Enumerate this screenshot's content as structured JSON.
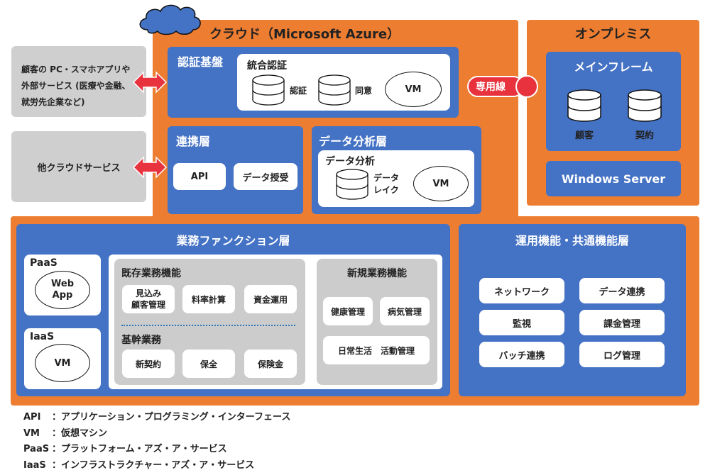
{
  "cloud": {
    "title": "クラウド（Microsoft Azure）",
    "auth_platform": {
      "title": "認証基盤",
      "integrated_auth": {
        "title": "統合認証",
        "db1_label": "認証",
        "db2_label": "同意",
        "vm_label": "VM"
      }
    },
    "integration_layer": {
      "title": "連携層",
      "items": [
        "API",
        "データ授受"
      ]
    },
    "analytics_layer": {
      "title": "データ分析層",
      "box_title": "データ分析",
      "datalake_label_1": "データ",
      "datalake_label_2": "レイク",
      "vm_label": "VM"
    },
    "business_layer": {
      "title": "業務ファンクション層",
      "paas": {
        "label": "PaaS",
        "ellipse_1": "Web",
        "ellipse_2": "App"
      },
      "iaas": {
        "label": "IaaS",
        "ellipse": "VM"
      },
      "existing": {
        "title": "既存業務機能",
        "items": [
          "見込み\n顧客管理",
          "料率計算",
          "資金運用"
        ],
        "item0_line1": "見込み",
        "item0_line2": "顧客管理",
        "sub_title": "基幹業務",
        "core_items": [
          "新契約",
          "保全",
          "保険金"
        ]
      },
      "new": {
        "title": "新規業務機能",
        "items": [
          "健康管理",
          "病気管理",
          "日常生活　活動管理"
        ]
      }
    },
    "ops_layer": {
      "title": "運用機能・共通機能層",
      "items": [
        "ネットワーク",
        "データ連携",
        "監視",
        "課金管理",
        "バッチ連携",
        "ログ管理"
      ]
    }
  },
  "onprem": {
    "title": "オンプレミス",
    "mainframe": {
      "title": "メインフレーム",
      "db1_label": "顧客",
      "db2_label": "契約"
    },
    "windows_server": "Windows Server"
  },
  "dedicated_line": "専用線",
  "external": {
    "customer": [
      "顧客の PC・スマホアプリや",
      "外部サービス (医療や金融、",
      "就労先企業など)"
    ],
    "other_cloud": "他クラウドサービス"
  },
  "legend": [
    {
      "abbr": "API",
      "sep": "：",
      "text": "アプリケーション・プログラミング・インターフェース"
    },
    {
      "abbr": "VM",
      "sep": "：",
      "text": "仮想マシン"
    },
    {
      "abbr": "PaaS",
      "sep": "：",
      "text": "プラットフォーム・アズ・ア・サービス"
    },
    {
      "abbr": "IaaS",
      "sep": "：",
      "text": "インフラストラクチャー・アズ・ア・サービス"
    }
  ],
  "colors": {
    "orange": "#ED7D31",
    "blue": "#4472C4",
    "red": "#E8333E",
    "grey": "#CFCFCF"
  }
}
